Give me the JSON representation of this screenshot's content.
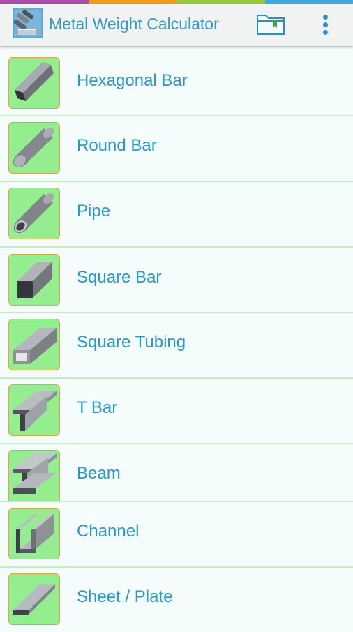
{
  "colors": {
    "stripe": [
      "#b04aa8",
      "#f39a1d",
      "#9ac83a",
      "#3fa9e0"
    ],
    "accent": "#2a98c9",
    "thumb_bg": "#94ee90",
    "thumb_border": "#e9a23b",
    "divider": "#c6ecc2"
  },
  "appbar": {
    "title": "Metal Weight Calculator",
    "logo_icon": "metal-bars-app-icon",
    "actions": [
      {
        "name": "folder-icon"
      },
      {
        "name": "overflow-menu-icon"
      }
    ]
  },
  "items": [
    {
      "label": "Hexagonal Bar",
      "icon": "hexagonal-bar-icon"
    },
    {
      "label": "Round Bar",
      "icon": "round-bar-icon"
    },
    {
      "label": "Pipe",
      "icon": "pipe-icon"
    },
    {
      "label": "Square Bar",
      "icon": "square-bar-icon"
    },
    {
      "label": "Square Tubing",
      "icon": "square-tubing-icon"
    },
    {
      "label": "T Bar",
      "icon": "t-bar-icon"
    },
    {
      "label": "Beam",
      "icon": "beam-icon"
    },
    {
      "label": "Channel",
      "icon": "channel-icon"
    },
    {
      "label": "Sheet / Plate",
      "icon": "sheet-plate-icon"
    }
  ]
}
